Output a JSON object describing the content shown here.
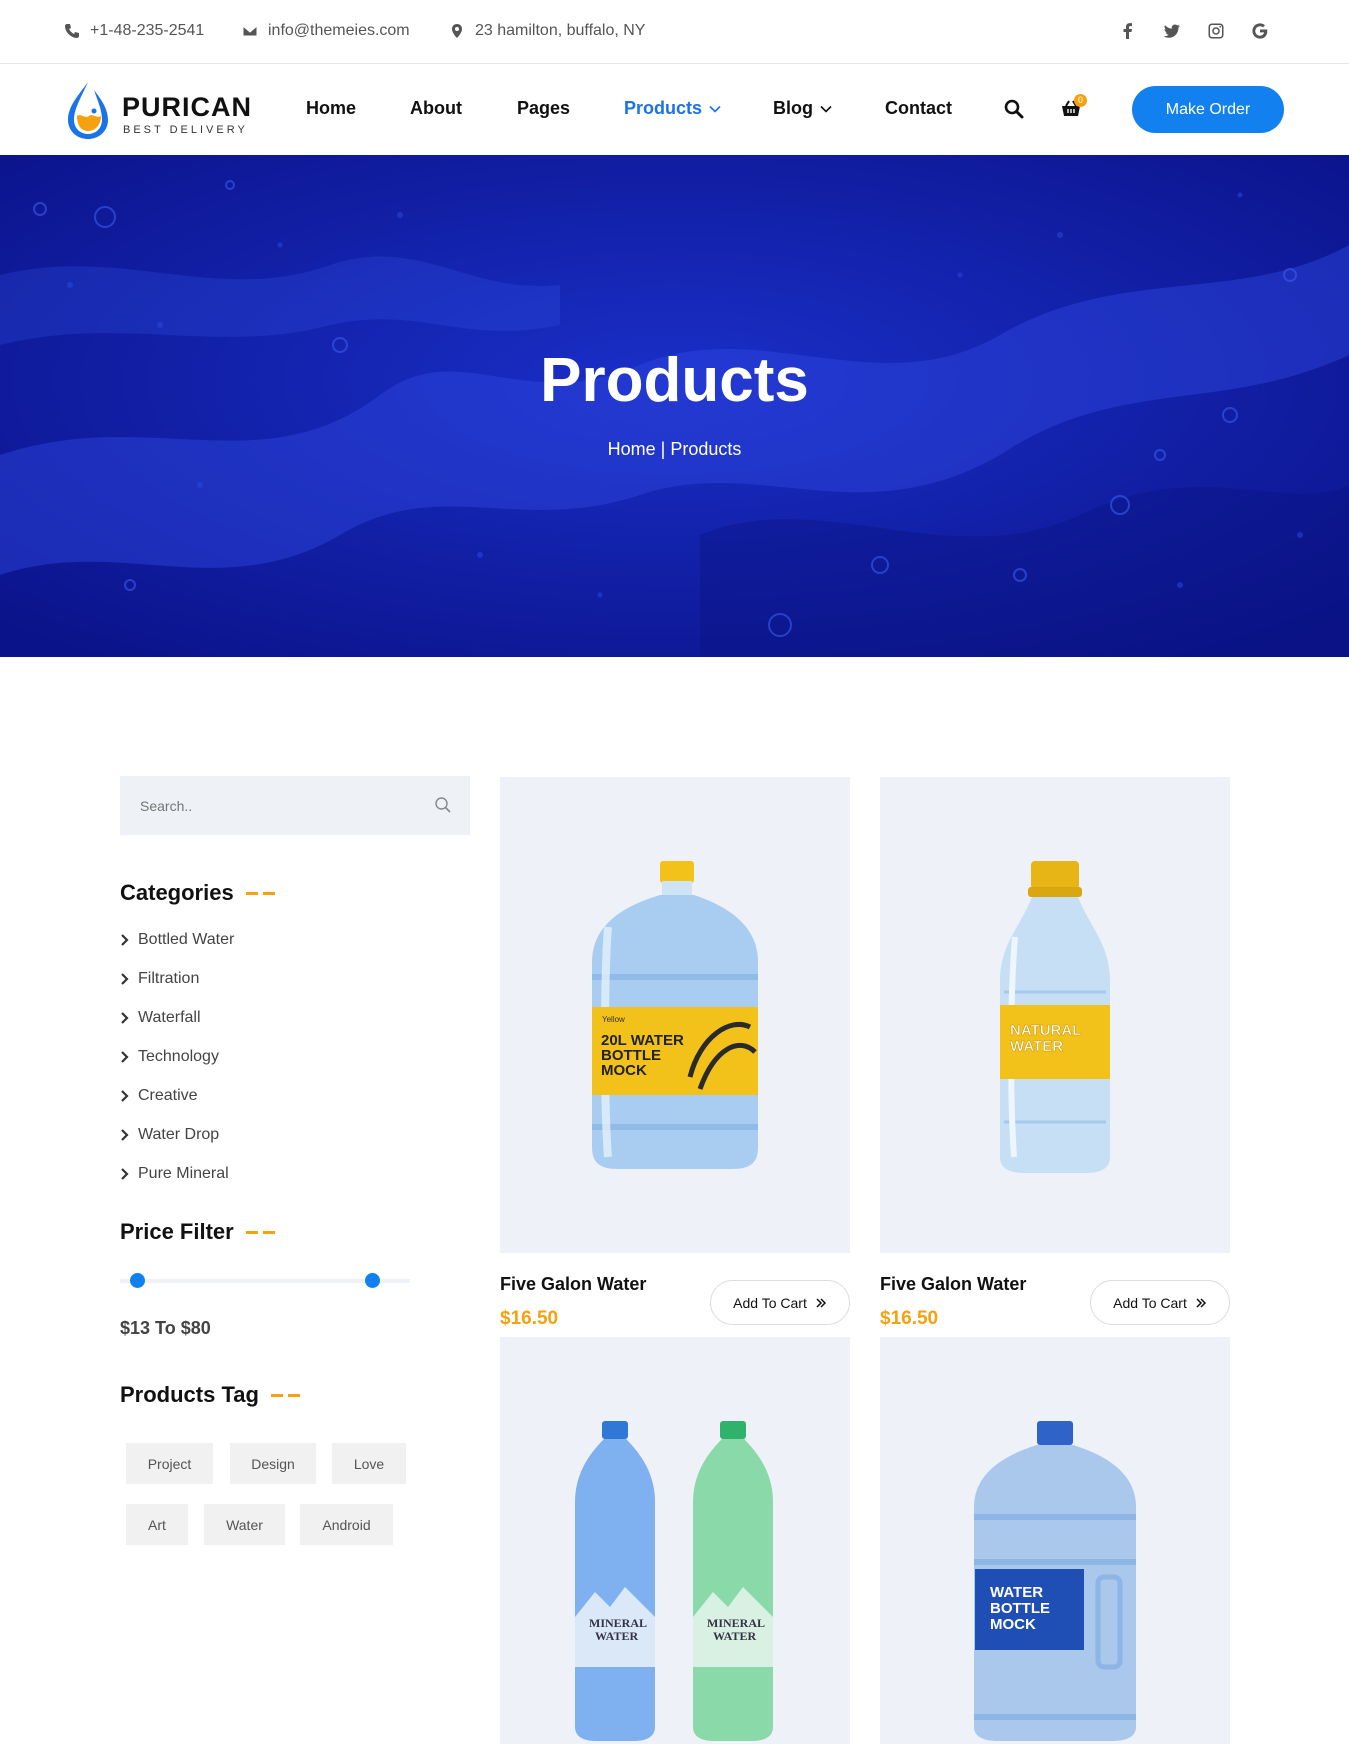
{
  "topbar": {
    "phone": "+1-48-235-2541",
    "email": "info@themeies.com",
    "address": "23 hamilton, buffalo, NY",
    "social": [
      "facebook-icon",
      "twitter-icon",
      "instagram-icon",
      "google-icon"
    ]
  },
  "header": {
    "logo_name": "PURICAN",
    "logo_tag": "BEST DELIVERY",
    "nav": [
      {
        "label": "Home"
      },
      {
        "label": "About"
      },
      {
        "label": "Pages"
      },
      {
        "label": "Products"
      },
      {
        "label": "Blog"
      },
      {
        "label": "Contact"
      }
    ],
    "cart_count": "0",
    "cta": "Make Order"
  },
  "hero": {
    "title": "Products",
    "breadcrumb_home": "Home",
    "breadcrumb_sep": " | ",
    "breadcrumb_current": "Products"
  },
  "sidebar": {
    "search_placeholder": "Search..",
    "categories_title": "Categories",
    "categories": [
      "Bottled Water",
      "Filtration",
      "Waterfall",
      "Technology",
      "Creative",
      "Water Drop",
      "Pure Mineral"
    ],
    "price_title": "Price Filter",
    "price_range_text": "$13 To $80",
    "price_min": 13,
    "price_max": 80,
    "tags_title": "Products Tag",
    "tags": [
      "Project",
      "Design",
      "Love",
      "Art",
      "Water",
      "Android"
    ]
  },
  "products": [
    {
      "name": "Five Galon Water",
      "price": "$16.50",
      "button": "Add To Cart",
      "label_text": "20L WATER BOTTLE MOCK",
      "label_small": "Yellow"
    },
    {
      "name": "Five Galon Water",
      "price": "$16.50",
      "button": "Add To Cart",
      "label_text": "NATURAL WATER"
    },
    {
      "name": "",
      "price": "",
      "button": "",
      "label_text": "MINERAL WATER"
    },
    {
      "name": "",
      "price": "",
      "button": "",
      "label_text": "WATER BOTTLE MOCK"
    }
  ],
  "colors": {
    "accent": "#1380ef",
    "price": "#f6a10e",
    "hero": "#0f1ea0",
    "card_bg": "#eef1f8"
  }
}
